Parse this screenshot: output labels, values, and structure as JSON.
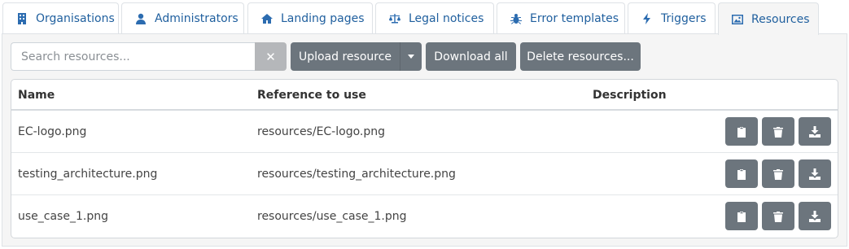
{
  "tabs": [
    {
      "label": "Organisations",
      "icon": "building-icon"
    },
    {
      "label": "Administrators",
      "icon": "user-icon"
    },
    {
      "label": "Landing pages",
      "icon": "home-icon"
    },
    {
      "label": "Legal notices",
      "icon": "balance-scale-icon"
    },
    {
      "label": "Error templates",
      "icon": "bug-icon"
    },
    {
      "label": "Triggers",
      "icon": "bolt-icon"
    },
    {
      "label": "Resources",
      "icon": "image-icon",
      "active": true
    }
  ],
  "toolbar": {
    "search_placeholder": "Search resources...",
    "clear_label": "✕",
    "upload_label": "Upload resource",
    "download_all_label": "Download all",
    "delete_label": "Delete resources..."
  },
  "table": {
    "headers": {
      "name": "Name",
      "reference": "Reference to use",
      "description": "Description"
    },
    "rows": [
      {
        "name": "EC-logo.png",
        "reference": "resources/EC-logo.png",
        "description": ""
      },
      {
        "name": "testing_architecture.png",
        "reference": "resources/testing_architecture.png",
        "description": ""
      },
      {
        "name": "use_case_1.png",
        "reference": "resources/use_case_1.png",
        "description": ""
      }
    ],
    "row_actions": [
      "clipboard-icon",
      "trash-icon",
      "download-icon"
    ]
  },
  "colors": {
    "accent": "#2c6cb0",
    "button": "#6c757d",
    "panel": "#f5f5f5"
  }
}
